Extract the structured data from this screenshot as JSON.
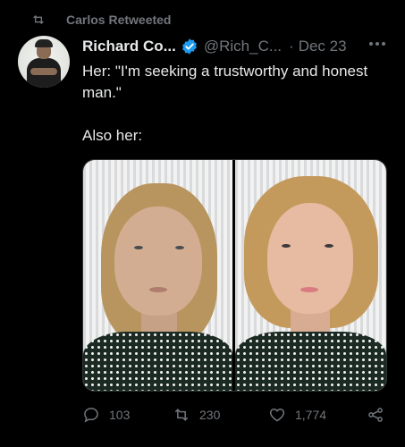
{
  "retweet": {
    "icon": "retweet-icon",
    "text": "Carlos Retweeted"
  },
  "author": {
    "name": "Richard Co...",
    "handle": "@Rich_C...",
    "date": "Dec 23",
    "avatar_icon": "avatar-image",
    "verified_icon": "verified-badge-icon",
    "verified_color": "#1d9bf0"
  },
  "tweet": {
    "line1": "Her:  \"I'm seeking a trustworthy and honest man.\"",
    "line2": "Also her:"
  },
  "media": {
    "left_photo": "woman-without-makeup-photo",
    "right_photo": "woman-with-makeup-photo"
  },
  "actions": {
    "replies": "103",
    "retweets": "230",
    "likes": "1,774"
  },
  "colors": {
    "background": "#000000",
    "text": "#e7e9ea",
    "secondary": "#71767b"
  }
}
